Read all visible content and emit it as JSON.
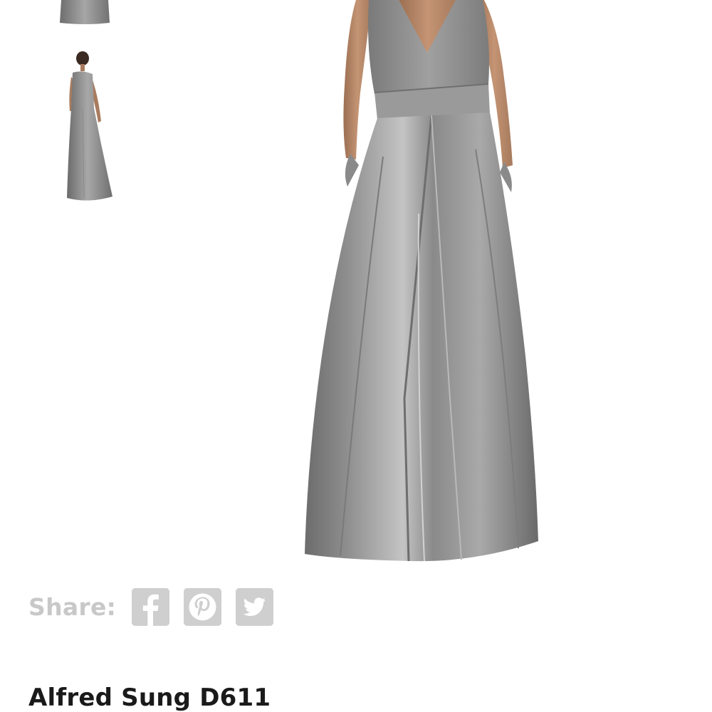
{
  "gallery": {
    "thumbnails": [
      {
        "alt": "dress-thumbnail-front-icon"
      },
      {
        "alt": "dress-thumbnail-back-icon"
      }
    ],
    "main_image": {
      "alt": "gray-satin-gown-photo"
    }
  },
  "share": {
    "label": "Share:",
    "icons": [
      "facebook-icon",
      "pinterest-icon",
      "twitter-icon"
    ]
  },
  "product": {
    "title": "Alfred Sung D611"
  },
  "colors": {
    "dress": "#8a8a8a",
    "skin": "#b98a6b",
    "share_gray": "#cfcfcf",
    "title": "#1a1a1a"
  }
}
